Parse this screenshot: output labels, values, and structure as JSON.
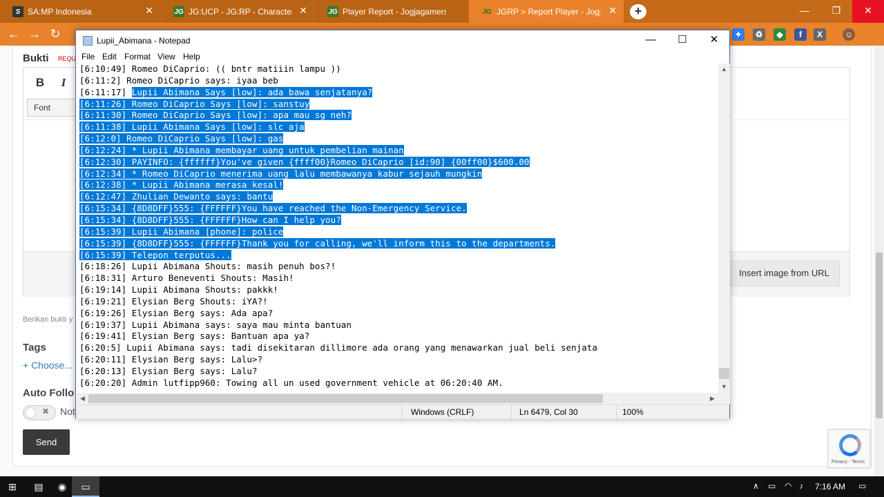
{
  "browser": {
    "tabs": [
      {
        "title": "SA:MP Indonesia",
        "active": false
      },
      {
        "title": "JG:UCP - JG:RP - Characters",
        "active": false
      },
      {
        "title": "Player Report - Jogjagamers Cor",
        "active": false
      },
      {
        "title": "JGRP > Report Player - Jogjagam",
        "active": true
      }
    ],
    "new_tab": "+",
    "colors": {
      "tabbar": "#c46a18",
      "toolbar": "#e8822b",
      "selection": "#0078d7"
    }
  },
  "page": {
    "bukti_label": "Bukti",
    "required_tag": "REQU",
    "bold_btn": "B",
    "italic_btn": "I",
    "font_select": "Font",
    "insert_url_btn": "Insert image from URL",
    "hint": "Berikan bukti y",
    "tags_label": "Tags",
    "choose_link": "+ Choose...",
    "auto_follow_label": "Auto Follo",
    "toggle_text": "✖",
    "not_label": "Not",
    "send_btn": "Send",
    "recaptcha_text": "Privacy - Terms"
  },
  "notepad": {
    "title": "Lupii_Abimana - Notepad",
    "menu": [
      "File",
      "Edit",
      "Format",
      "View",
      "Help"
    ],
    "lines": [
      {
        "text": "[6:10:49] Romeo DiCaprio: (( bntr matiiin lampu ))",
        "sel": false
      },
      {
        "text": "[6:11:2] Romeo DiCaprio says: iyaa beb",
        "sel": false
      },
      {
        "prefix": "[6:11:17] ",
        "text": "Lupii Abimana Says [low]: ada bawa senjatanya?",
        "sel": "partial"
      },
      {
        "text": "[6:11:26] Romeo DiCaprio Says [low]: sanstuy",
        "sel": true
      },
      {
        "text": "[6:11:30] Romeo DiCaprio Says [low]: apa mau sg neh?",
        "sel": true
      },
      {
        "text": "[6:11:38] Lupii Abimana Says [low]: slc aja",
        "sel": true
      },
      {
        "text": "[6:12:0] Romeo DiCaprio Says [low]: gas",
        "sel": true
      },
      {
        "text": "[6:12:24] * Lupii Abimana membayar uang untuk pembelian mainan",
        "sel": true
      },
      {
        "text": "[6:12:30] PAYINFO: {ffffff}You've given {ffff00}Romeo DiCaprio [id:90] {00ff00}$600.00",
        "sel": true
      },
      {
        "text": "[6:12:34] * Romeo DiCaprio menerima uang lalu membawanya kabur sejauh mungkin",
        "sel": true
      },
      {
        "text": "[6:12:38] * Lupii Abimana merasa kesal!",
        "sel": true
      },
      {
        "text": "[6:12:47] Zhulian Dewanto says: bantu",
        "sel": true
      },
      {
        "text": "[6:15:34] {8D8DFF}555: {FFFFFF}You have reached the Non-Emergency Service.",
        "sel": true
      },
      {
        "text": "[6:15:34] {8D8DFF}555: {FFFFFF}How can I help you?",
        "sel": true
      },
      {
        "text": "[6:15:39] Lupii Abimana [phone]: police",
        "sel": true
      },
      {
        "text": "[6:15:39] {8D8DFF}555: {FFFFFF}Thank you for calling, we'll inform this to the departments.",
        "sel": true
      },
      {
        "text": "[6:15:39] Telepon terputus...",
        "sel": true
      },
      {
        "text": "[6:18:26] Lupii Abimana Shouts: masih penuh bos?!",
        "sel": false
      },
      {
        "text": "[6:18:31] Arturo Beneventi Shouts: Masih!",
        "sel": false
      },
      {
        "text": "[6:19:14] Lupii Abimana Shouts: pakkk!",
        "sel": false
      },
      {
        "text": "[6:19:21] Elysian Berg Shouts: iYA?!",
        "sel": false
      },
      {
        "text": "[6:19:26] Elysian Berg says: Ada apa?",
        "sel": false
      },
      {
        "text": "[6:19:37] Lupii Abimana says: saya mau minta bantuan",
        "sel": false
      },
      {
        "text": "[6:19:41] Elysian Berg says: Bantuan apa ya?",
        "sel": false
      },
      {
        "text": "[6:20:5] Lupii Abimana says: tadi disekitaran dillimore ada orang yang menawarkan jual beli senjata",
        "sel": false
      },
      {
        "text": "[6:20:11] Elysian Berg says: Lalu>?",
        "sel": false
      },
      {
        "text": "[6:20:13] Elysian Berg says: Lalu?",
        "sel": false
      },
      {
        "text": "[6:20:20] Admin lutfipp960: Towing all un used government vehicle at 06:20:40 AM.",
        "sel": false
      }
    ],
    "status": {
      "eol": "Windows (CRLF)",
      "pos": "Ln 6479, Col 30",
      "zoom": "100%"
    }
  },
  "taskbar": {
    "time": "7:16 AM",
    "tray": "∧"
  }
}
